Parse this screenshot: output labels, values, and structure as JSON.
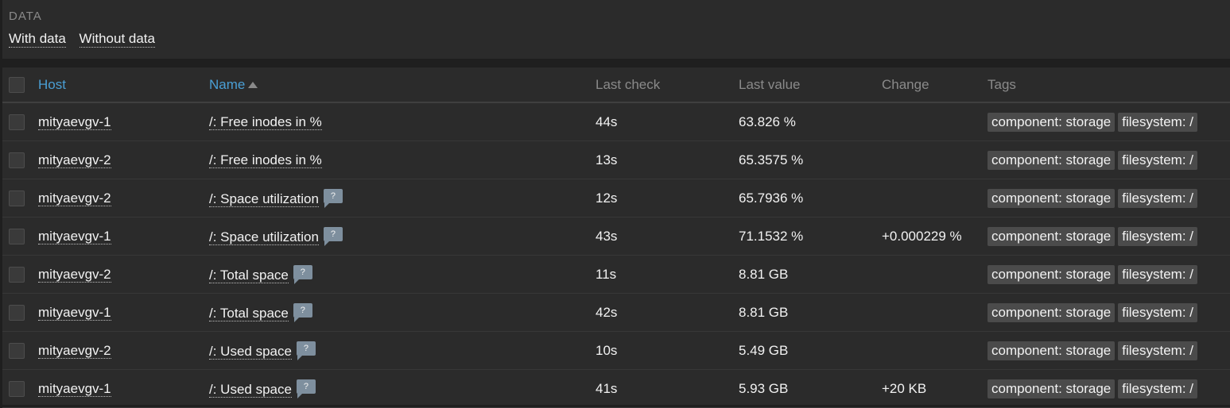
{
  "filter": {
    "label": "DATA",
    "options": [
      "With data",
      "Without data"
    ]
  },
  "columns": {
    "host": "Host",
    "name": "Name",
    "last_check": "Last check",
    "last_value": "Last value",
    "change": "Change",
    "tags": "Tags"
  },
  "hint_glyph": "?",
  "colors": {
    "header_sort_link": "#4a9fd5",
    "hint_background": "#7e8f9e",
    "tag_background": "#4b4b4b"
  },
  "rows": [
    {
      "host": "mityaevgv-1",
      "name": "/: Free inodes in %",
      "hint": false,
      "last_check": "44s",
      "last_value": "63.826 %",
      "change": "",
      "tags": [
        "component: storage",
        "filesystem: /"
      ]
    },
    {
      "host": "mityaevgv-2",
      "name": "/: Free inodes in %",
      "hint": false,
      "last_check": "13s",
      "last_value": "65.3575 %",
      "change": "",
      "tags": [
        "component: storage",
        "filesystem: /"
      ]
    },
    {
      "host": "mityaevgv-2",
      "name": "/: Space utilization",
      "hint": true,
      "last_check": "12s",
      "last_value": "65.7936 %",
      "change": "",
      "tags": [
        "component: storage",
        "filesystem: /"
      ]
    },
    {
      "host": "mityaevgv-1",
      "name": "/: Space utilization",
      "hint": true,
      "last_check": "43s",
      "last_value": "71.1532 %",
      "change": "+0.000229 %",
      "tags": [
        "component: storage",
        "filesystem: /"
      ]
    },
    {
      "host": "mityaevgv-2",
      "name": "/: Total space",
      "hint": true,
      "last_check": "11s",
      "last_value": "8.81 GB",
      "change": "",
      "tags": [
        "component: storage",
        "filesystem: /"
      ]
    },
    {
      "host": "mityaevgv-1",
      "name": "/: Total space",
      "hint": true,
      "last_check": "42s",
      "last_value": "8.81 GB",
      "change": "",
      "tags": [
        "component: storage",
        "filesystem: /"
      ]
    },
    {
      "host": "mityaevgv-2",
      "name": "/: Used space",
      "hint": true,
      "last_check": "10s",
      "last_value": "5.49 GB",
      "change": "",
      "tags": [
        "component: storage",
        "filesystem: /"
      ]
    },
    {
      "host": "mityaevgv-1",
      "name": "/: Used space",
      "hint": true,
      "last_check": "41s",
      "last_value": "5.93 GB",
      "change": "+20 KB",
      "tags": [
        "component: storage",
        "filesystem: /"
      ]
    }
  ]
}
